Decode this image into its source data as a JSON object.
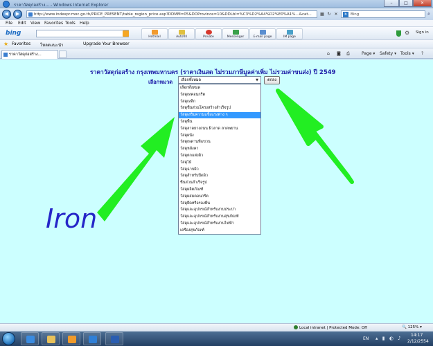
{
  "window": {
    "title": "ราคาวัสดุก่อสร้าง... - Windows Internet Explorer",
    "url": "http://www.indexpr.moc.go.th/PRICE_PRESENT/table_region_price.asp?DDMM=05&DDProvince=10&DDLbl=%C3%D2%A4%D2%E0%A1%...&cat...",
    "search_placeholder": "Bing"
  },
  "menu": [
    "File",
    "Edit",
    "View",
    "Favorites",
    "Tools",
    "Help"
  ],
  "bing_toolbar": {
    "logo": "bing",
    "buttons": [
      "Hotmail",
      "Autofill",
      "Private",
      "Messenger",
      "E-mail page",
      "IM page"
    ],
    "signin": "Sign in"
  },
  "favorites_bar": {
    "label": "Favorites",
    "items": [
      "โหลดแนะนำ",
      "Upgrade Your Browser"
    ]
  },
  "tab": {
    "title": "ราคาวัสดุก่อสร้าง..."
  },
  "command_bar": [
    "Page ▾",
    "Safety ▾",
    "Tools ▾"
  ],
  "page": {
    "heading": "ราคาวัสดุก่อสร้าง กรุงเทพมหานคร (ราคาเงินสด ไม่รวมภาษีมูลค่าเพิ่ม ไม่รวมค่าขนส่ง) ปี 2549",
    "category_label": "เลือกหมวด",
    "selected_value": "เลือกทั้งหมด",
    "ok_button": "ตกลง",
    "options": [
      "เลือกทั้งหมด",
      "วัสดุเทคอนกรีต",
      "วัสดุเหล็ก",
      "วัสดุชิ้นส่วนโครงสร้างสำเร็จรูป",
      "วัสดุเสริมความแข็งแรงต่าง ๆ",
      "วัสดุพื้น",
      "วัสดุลาดยางถนน ผิวลาด ลาดพยาน",
      "วัสดุผนัง",
      "วัสดุเพดานที่แขวน",
      "วัสดุหลังคา",
      "วัสดุตกแต่งผิว",
      "วัสดุไม้",
      "วัสดุฉาบผิว",
      "วัสดุสำหรับปิดผิว",
      "ชิ้นส่วนสำเร็จรูป",
      "วัสดุผลิตภัณฑ์",
      "วัสดุผสมคอนกรีต",
      "วัสดุยึดหรือรองพื้น",
      "วัสดุและอุปกรณ์สำหรับงานประปา",
      "วัสดุและอุปกรณ์สำหรับงานสุขภัณฑ์",
      "วัสดุและอุปกรณ์สำหรับงานไฟฟ้า",
      "เครื่องสุขภัณฑ์"
    ],
    "highlighted_index": 4,
    "annotation": "Iron"
  },
  "status": {
    "zone": "Local intranet | Protected Mode: Off",
    "zoom": "125%"
  },
  "taskbar": {
    "lang": "EN",
    "time": "14:17",
    "date": "2/12/2554"
  },
  "colors": {
    "page_bg": "#ccffff",
    "heading": "#1e1ea8",
    "arrow": "#22ee22",
    "highlight": "#3399ff"
  }
}
